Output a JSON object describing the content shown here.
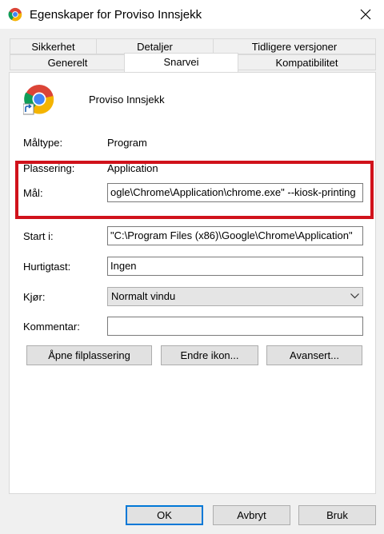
{
  "window": {
    "title": "Egenskaper for Proviso Innsjekk",
    "close_icon": "close-icon",
    "app_icon": "chrome-icon"
  },
  "tabs": {
    "row1": [
      "Sikkerhet",
      "Detaljer",
      "Tidligere versjoner"
    ],
    "row2": [
      "Generelt",
      "Snarvei",
      "Kompatibilitet"
    ],
    "active": "Snarvei"
  },
  "shortcut": {
    "name": "Proviso Innsjekk",
    "target_type_label": "Måltype:",
    "target_type_value": "Program",
    "location_label": "Plassering:",
    "location_value": "Application",
    "target_label": "Mål:",
    "target_value": "ogle\\Chrome\\Application\\chrome.exe\" --kiosk-printing",
    "start_in_label": "Start i:",
    "start_in_value": "\"C:\\Program Files (x86)\\Google\\Chrome\\Application\"",
    "shortcut_key_label": "Hurtigtast:",
    "shortcut_key_value": "Ingen",
    "run_label": "Kjør:",
    "run_value": "Normalt vindu",
    "comment_label": "Kommentar:",
    "comment_value": ""
  },
  "actions": {
    "open_location": "Åpne filplassering",
    "change_icon": "Endre ikon...",
    "advanced": "Avansert..."
  },
  "footer": {
    "ok": "OK",
    "cancel": "Avbryt",
    "apply": "Bruk"
  },
  "colors": {
    "highlight": "#d0121b",
    "default_button_border": "#0078d7"
  }
}
